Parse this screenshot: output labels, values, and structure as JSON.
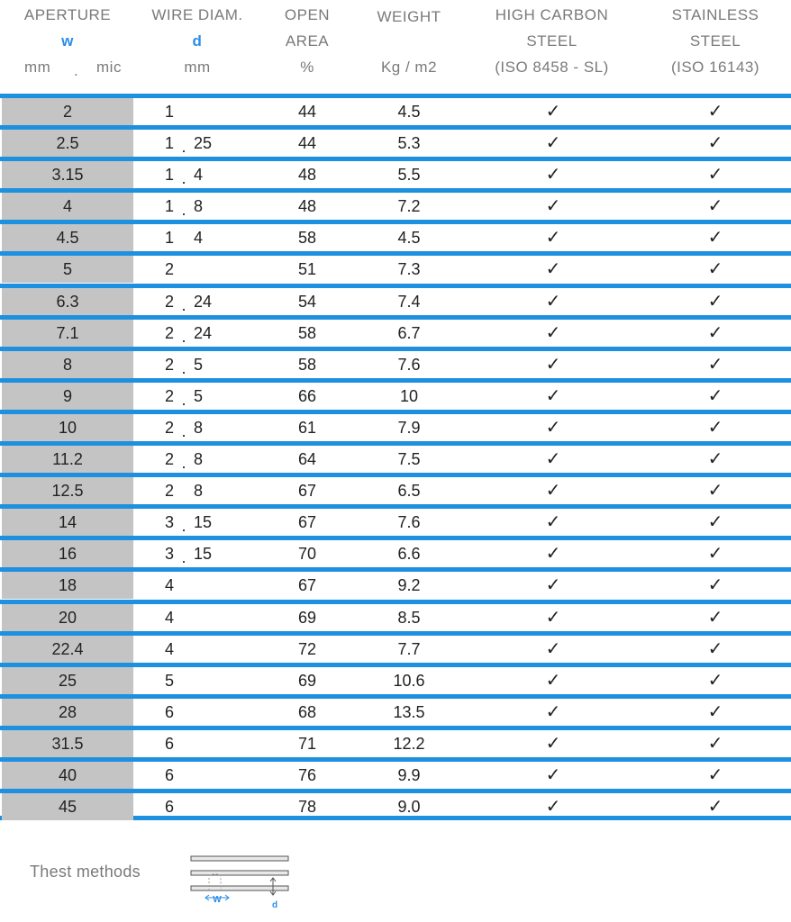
{
  "headers": {
    "aperture": {
      "title": "APERTURE",
      "symbol": "w",
      "unit_left": "mm",
      "unit_sep": ".",
      "unit_right": "mic"
    },
    "wire_diam": {
      "title": "WIRE DIAM.",
      "symbol": "d",
      "unit": "mm"
    },
    "open_area": {
      "line1": "OPEN",
      "line2": "AREA",
      "unit": "%"
    },
    "weight": {
      "title": "WEIGHT",
      "unit": "Kg / m2"
    },
    "high_carbon": {
      "line1": "HIGH CARBON",
      "line2": "STEEL",
      "line3": "(ISO 8458 - SL)"
    },
    "stainless": {
      "line1": "STAINLESS",
      "line2": "STEEL",
      "line3": "(ISO 16143)"
    }
  },
  "check_symbol": "✓",
  "rows": [
    {
      "aperture": "2",
      "wire_int": "1",
      "wire_frac": "",
      "dot": "",
      "open_area": "44",
      "weight": "4.5"
    },
    {
      "aperture": "2.5",
      "wire_int": "1",
      "wire_frac": "25",
      "dot": ".",
      "open_area": "44",
      "weight": "5.3"
    },
    {
      "aperture": "3.15",
      "wire_int": "1",
      "wire_frac": "4",
      "dot": ".",
      "open_area": "48",
      "weight": "5.5"
    },
    {
      "aperture": "4",
      "wire_int": "1",
      "wire_frac": "8",
      "dot": ".",
      "open_area": "48",
      "weight": "7.2"
    },
    {
      "aperture": "4.5",
      "wire_int": "1",
      "wire_frac": "4",
      "dot": "",
      "open_area": "58",
      "weight": "4.5"
    },
    {
      "aperture": "5",
      "wire_int": "2",
      "wire_frac": "",
      "dot": "",
      "open_area": "51",
      "weight": "7.3"
    },
    {
      "aperture": "6.3",
      "wire_int": "2",
      "wire_frac": "24",
      "dot": ".",
      "open_area": "54",
      "weight": "7.4"
    },
    {
      "aperture": "7.1",
      "wire_int": "2",
      "wire_frac": "24",
      "dot": ".",
      "open_area": "58",
      "weight": "6.7"
    },
    {
      "aperture": "8",
      "wire_int": "2",
      "wire_frac": "5",
      "dot": ".",
      "open_area": "58",
      "weight": "7.6"
    },
    {
      "aperture": "9",
      "wire_int": "2",
      "wire_frac": "5",
      "dot": ".",
      "open_area": "66",
      "weight": "10"
    },
    {
      "aperture": "10",
      "wire_int": "2",
      "wire_frac": "8",
      "dot": ".",
      "open_area": "61",
      "weight": "7.9"
    },
    {
      "aperture": "11.2",
      "wire_int": "2",
      "wire_frac": "8",
      "dot": ".",
      "open_area": "64",
      "weight": "7.5"
    },
    {
      "aperture": "12.5",
      "wire_int": "2",
      "wire_frac": "8",
      "dot": "",
      "open_area": "67",
      "weight": "6.5"
    },
    {
      "aperture": "14",
      "wire_int": "3",
      "wire_frac": "15",
      "dot": ".",
      "open_area": "67",
      "weight": "7.6"
    },
    {
      "aperture": "16",
      "wire_int": "3",
      "wire_frac": "15",
      "dot": ".",
      "open_area": "70",
      "weight": "6.6"
    },
    {
      "aperture": "18",
      "wire_int": "4",
      "wire_frac": "",
      "dot": "",
      "open_area": "67",
      "weight": "9.2"
    },
    {
      "aperture": "20",
      "wire_int": "4",
      "wire_frac": "",
      "dot": "",
      "open_area": "69",
      "weight": "8.5"
    },
    {
      "aperture": "22.4",
      "wire_int": "4",
      "wire_frac": "",
      "dot": "",
      "open_area": "72",
      "weight": "7.7"
    },
    {
      "aperture": "25",
      "wire_int": "5",
      "wire_frac": "",
      "dot": "",
      "open_area": "69",
      "weight": "10.6"
    },
    {
      "aperture": "28",
      "wire_int": "6",
      "wire_frac": "",
      "dot": "",
      "open_area": "68",
      "weight": "13.5"
    },
    {
      "aperture": "31.5",
      "wire_int": "6",
      "wire_frac": "",
      "dot": "",
      "open_area": "71",
      "weight": "12.2"
    },
    {
      "aperture": "40",
      "wire_int": "6",
      "wire_frac": "",
      "dot": "",
      "open_area": "76",
      "weight": "9.9"
    },
    {
      "aperture": "45",
      "wire_int": "6",
      "wire_frac": "",
      "dot": "",
      "open_area": "78",
      "weight": "9.0"
    }
  ],
  "footer": {
    "label": "Thest methods",
    "diagram_w": "W",
    "diagram_d": "d"
  },
  "colors": {
    "rule_blue": "#1e90e0",
    "symbol_blue": "#2a8ee8",
    "aperture_bg": "#c4c4c4",
    "header_gray": "#7a7a7a"
  }
}
